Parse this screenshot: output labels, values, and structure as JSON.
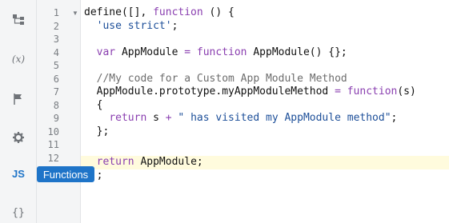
{
  "sidebar": {
    "fx_label": "(x)",
    "js_label": "JS",
    "braces_label": "{}",
    "tooltip": "Functions"
  },
  "gutter": {
    "line_numbers": [
      "1",
      "2",
      "3",
      "4",
      "5",
      "6",
      "7",
      "8",
      "9",
      "10",
      "11",
      "12",
      "13"
    ]
  },
  "code": {
    "l1_a": "define([], ",
    "l1_kw": "function",
    "l1_b": " () {",
    "l2_str": "'use strict'",
    "l2_b": ";",
    "l4_kw1": "var",
    "l4_a": " AppModule ",
    "l4_op": "=",
    "l4_sp": " ",
    "l4_kw2": "function",
    "l4_b": " AppModule() {};",
    "l6_cmt": "//My code for a Custom App Module Method",
    "l7_a": "AppModule.prototype.myAppModuleMethod ",
    "l7_op": "=",
    "l7_sp": " ",
    "l7_kw": "function",
    "l7_b": "(s)",
    "l8": "{",
    "l9_kw": "return",
    "l9_a": " s ",
    "l9_op": "+",
    "l9_sp": " ",
    "l9_str": "\" has visited my AppModule method\"",
    "l9_b": ";",
    "l10": "};",
    "l12_kw": "return",
    "l12_a": " AppModule;",
    "l13": "});"
  },
  "colors": {
    "keyword": "#8a3fb0",
    "string": "#1d4f99",
    "comment": "#6d6d6d",
    "accent": "#1e74c8",
    "active_line": "#fffbdd"
  }
}
